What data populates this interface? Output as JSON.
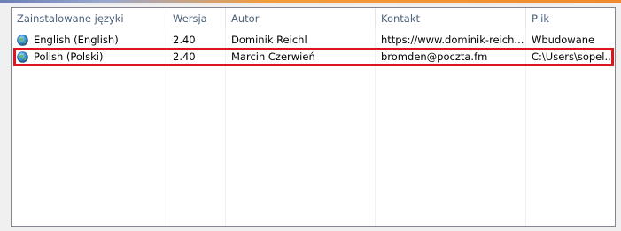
{
  "columns": {
    "language": "Zainstalowane języki",
    "version": "Wersja",
    "author": "Autor",
    "contact": "Kontakt",
    "file": "Plik"
  },
  "rows": [
    {
      "language": "English (English)",
      "version": "2.40",
      "author": "Dominik Reichl",
      "contact": "https://www.dominik-reich...",
      "file": "Wbudowane",
      "icon": "globe-icon"
    },
    {
      "language": "Polish (Polski)",
      "version": "2.40",
      "author": "Marcin Czerwień",
      "contact": "bromden@poczta.fm",
      "file": "C:\\Users\\sopel...",
      "icon": "globe-icon"
    }
  ],
  "colors": {
    "highlight": "#e0141e",
    "header_text": "#4c607a"
  }
}
